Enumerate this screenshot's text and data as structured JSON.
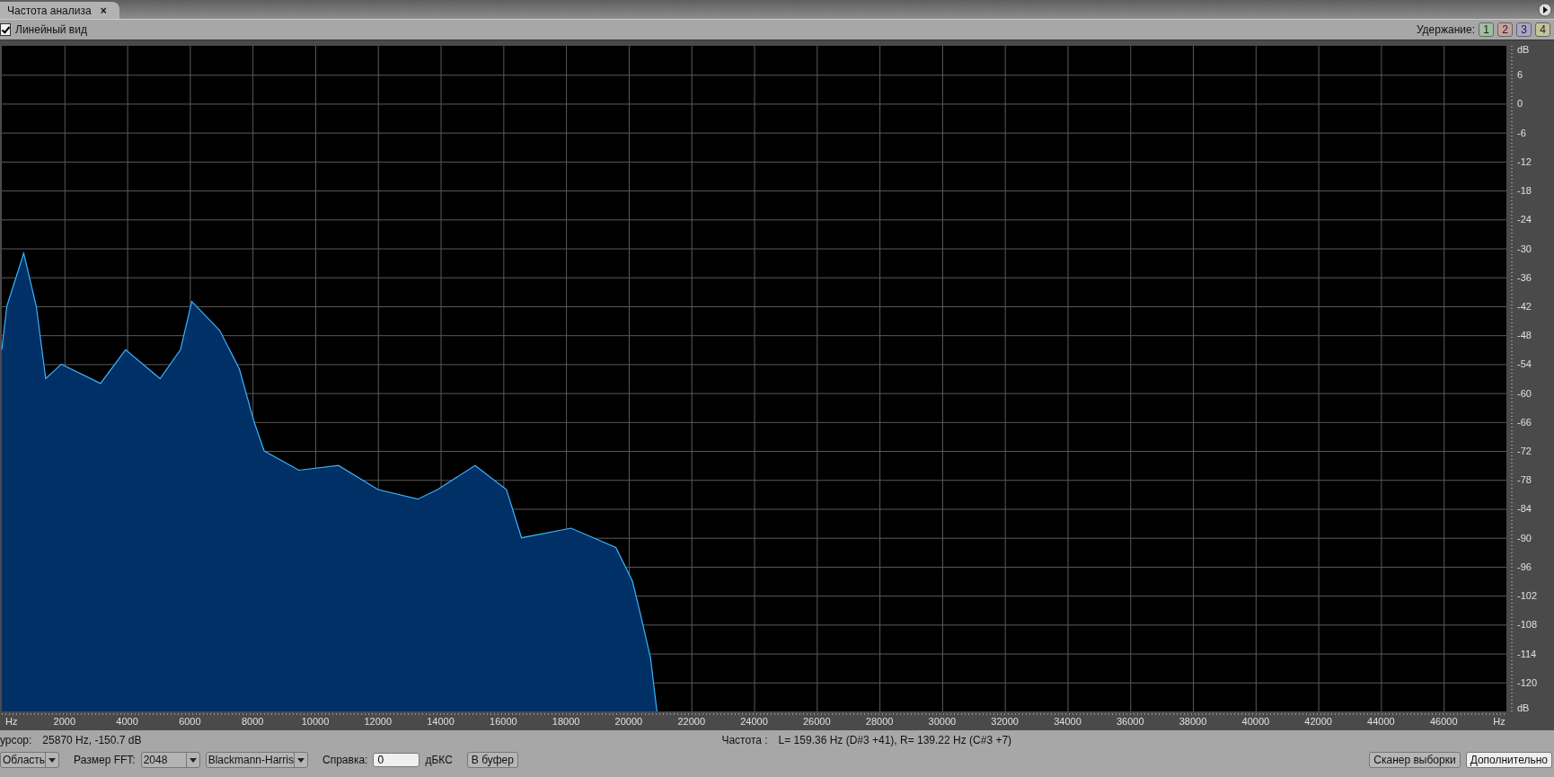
{
  "tab": {
    "title": "Частота  анализа",
    "close": "×"
  },
  "toolbar": {
    "linear_view": {
      "label": "Линейный вид",
      "checked": true
    },
    "hold_label": "Удержание:",
    "hold_buttons": [
      {
        "label": "1",
        "color": "#9fbf9f"
      },
      {
        "label": "2",
        "color": "#c9a0a0"
      },
      {
        "label": "3",
        "color": "#a8a6c8"
      },
      {
        "label": "4",
        "color": "#c3c39a"
      }
    ]
  },
  "plot": {
    "x_unit_left": "Hz",
    "y_unit_bottom": "dB",
    "chart_data": {
      "type": "area",
      "xlabel": "Hz",
      "ylabel": "dB",
      "x": [
        0,
        160,
        700,
        1100,
        1400,
        1900,
        3150,
        3950,
        5050,
        5700,
        6060,
        6950,
        7580,
        8050,
        8370,
        9480,
        10740,
        12000,
        13270,
        13900,
        15100,
        16100,
        16580,
        18160,
        19590,
        20120,
        20380,
        20700,
        20900
      ],
      "grid": true,
      "series": [
        {
          "color": "#3ab4ff",
          "values": [
            -51,
            -42,
            -31,
            -42,
            -57,
            -54,
            -58,
            -51,
            -57,
            -51,
            -41,
            -47,
            -55,
            -66,
            -72,
            -76,
            -75,
            -80,
            -82,
            -80,
            -75,
            -80,
            -90,
            -88,
            -92,
            -99,
            -106,
            -115,
            -126
          ]
        }
      ],
      "xlim": [
        0,
        48000
      ],
      "ylim": [
        -126,
        12
      ],
      "xticks": [
        2000,
        4000,
        6000,
        8000,
        10000,
        12000,
        14000,
        16000,
        18000,
        20000,
        22000,
        24000,
        26000,
        28000,
        30000,
        32000,
        34000,
        36000,
        38000,
        40000,
        42000,
        44000,
        46000
      ],
      "yticks": [
        6,
        0,
        -6,
        -12,
        -18,
        -24,
        -30,
        -36,
        -42,
        -48,
        -54,
        -60,
        -66,
        -72,
        -78,
        -84,
        -90,
        -96,
        -102,
        -108,
        -114,
        -120
      ]
    }
  },
  "status": {
    "cursor_label": "урсор:",
    "cursor_value": "25870 Hz, -150.7 dB",
    "frequency_label": "Частота :",
    "frequency_value": "L= 159.36 Hz (D#3 +41), R= 139.22 Hz (C#3 +7)"
  },
  "controls": {
    "range_dropdown": "Область",
    "fft_label": "Размер FFT:",
    "fft_dropdown": "2048",
    "window_dropdown": "Blackmann-Harris",
    "reference_label": "Справка:",
    "reference_value": "0",
    "reference_unit": "дБКС",
    "copy_button": "В буфер",
    "scan_button": "Сканер выборки",
    "advanced_button": "Дополнительно"
  }
}
